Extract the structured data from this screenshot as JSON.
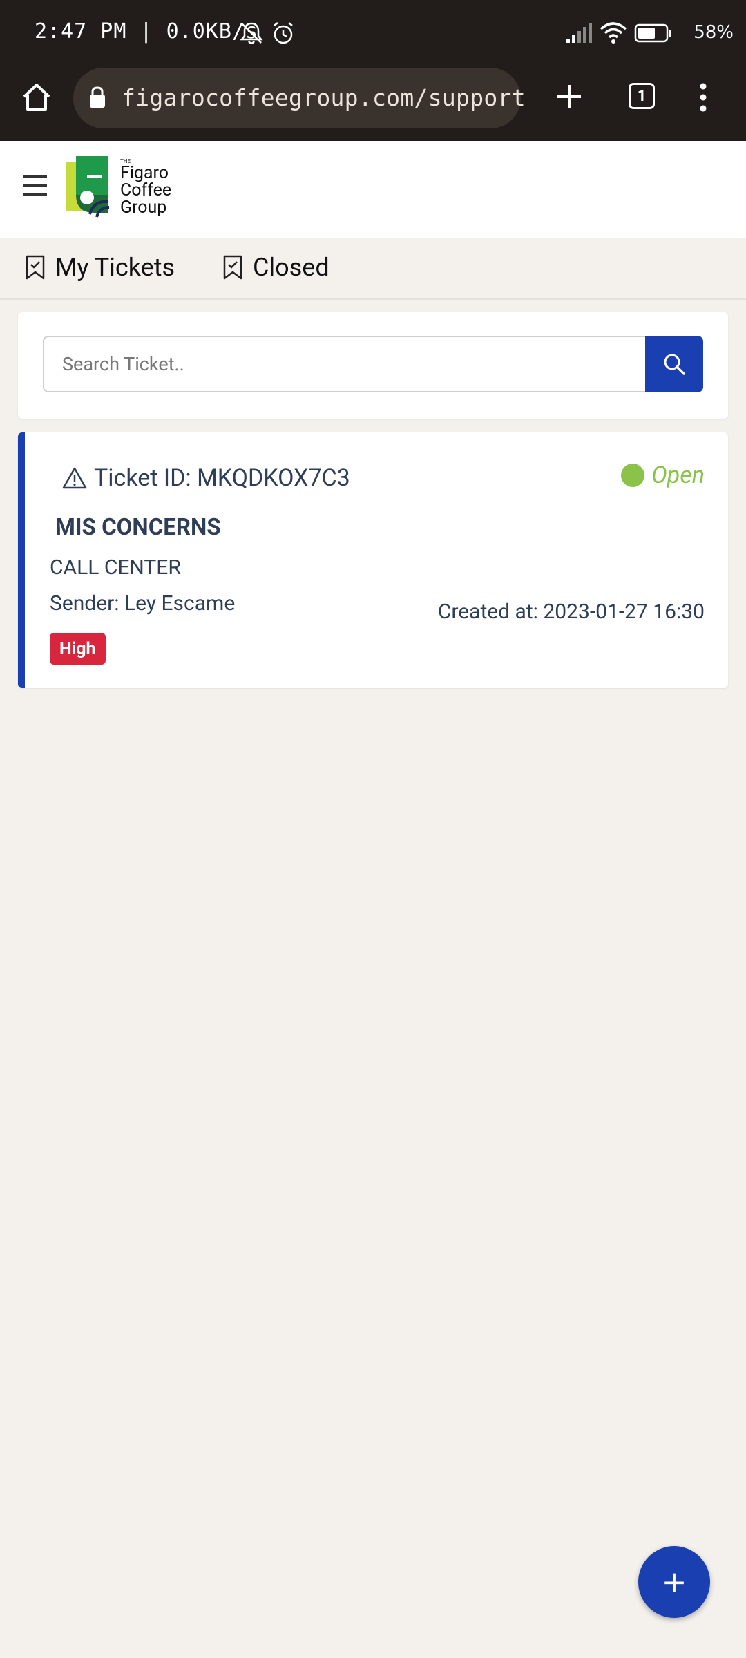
{
  "status_bar": {
    "time": "2:47 PM | 0.0KB/s",
    "battery": "58%",
    "icons": [
      "mute-icon",
      "alarm-icon",
      "signal-icon",
      "wifi-icon",
      "battery-icon"
    ]
  },
  "browser": {
    "url": "figarocoffeegroup.com/support",
    "tab_count": "1",
    "icons": [
      "home-icon",
      "lock-icon",
      "plus-icon",
      "tabs-icon",
      "menu-dots-icon"
    ]
  },
  "header": {
    "logo_text": [
      "THE",
      "Figaro",
      "Coffee",
      "Group"
    ]
  },
  "tabs": [
    {
      "label": "My Tickets"
    },
    {
      "label": "Closed"
    }
  ],
  "search": {
    "placeholder": "Search Ticket.."
  },
  "tickets": [
    {
      "id_label": "Ticket ID: MKQDKOX7C3",
      "status": "Open",
      "title": "MIS CONCERNS",
      "department": "CALL CENTER",
      "sender": "Sender: Ley Escame",
      "created": "Created at: 2023-01-27 16:30",
      "priority": "High",
      "status_color": "#8bc34a",
      "priority_color": "#d7263d"
    }
  ],
  "fab": {
    "label": "+"
  },
  "colors": {
    "accent": "#1a3fb0",
    "background": "#f4f1ed",
    "status_bar": "#221d1a"
  }
}
